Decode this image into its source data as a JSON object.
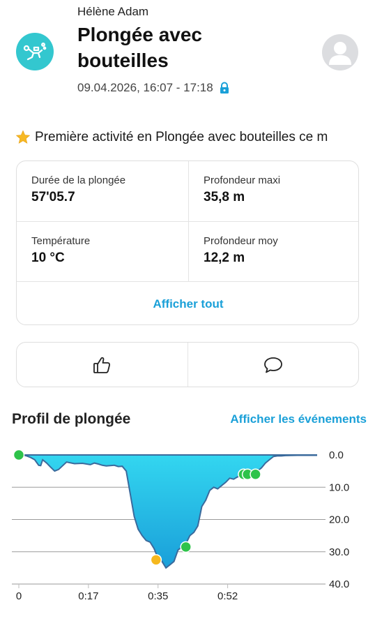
{
  "header": {
    "user_name": "Hélène Adam",
    "title": "Plongée avec bouteilles",
    "datetime": "09.04.2026, 16:07 - 17:18",
    "activity_icon": "scuba-diver-icon",
    "lock_icon": "lock-icon",
    "avatar_icon": "user-avatar-icon",
    "accent_color": "#33c7cf"
  },
  "achievement": {
    "icon": "star-icon",
    "text": "Première activité en Plongée avec bouteilles ce m"
  },
  "stats": {
    "duration": {
      "label": "Durée de la plongée",
      "value": "57'05.7"
    },
    "max_depth": {
      "label": "Profondeur maxi",
      "value": "35,8 m"
    },
    "temperature": {
      "label": "Température",
      "value": "10 °C"
    },
    "avg_depth": {
      "label": "Profondeur moy",
      "value": "12,2 m"
    },
    "show_all": "Afficher tout"
  },
  "actions": {
    "like_icon": "thumbs-up-icon",
    "comment_icon": "comment-icon"
  },
  "profile": {
    "title": "Profil de plongée",
    "events_link": "Afficher les événements"
  },
  "chart_data": {
    "type": "area",
    "title": "",
    "xlabel": "",
    "ylabel": "",
    "x_ticks": [
      "0",
      "0:17",
      "0:35",
      "0:52"
    ],
    "x_tick_minutes": [
      0,
      17.5,
      35,
      52.5
    ],
    "y_ticks": [
      "0.0",
      "10.0",
      "20.0",
      "30.0",
      "40.0"
    ],
    "ylim": [
      0,
      40
    ],
    "xlim": [
      0,
      75
    ],
    "y_inverted": true,
    "grid": true,
    "series": [
      {
        "color": "#1fb4e4",
        "x": [
          0,
          1,
          2,
          3,
          4,
          5,
          5.5,
          6,
          7,
          8,
          9,
          10,
          12,
          14,
          16,
          18,
          19,
          20,
          21,
          22,
          23,
          24,
          25,
          26,
          27,
          28,
          29,
          30,
          31,
          32,
          33,
          34,
          35,
          36,
          37,
          38,
          39,
          40,
          41,
          42,
          43,
          44,
          45,
          46,
          47,
          48,
          49,
          50,
          51,
          52,
          53,
          54,
          55,
          56,
          57,
          58,
          59,
          60,
          61,
          62,
          63,
          64,
          65,
          66,
          67,
          70,
          72,
          75
        ],
        "y": [
          0,
          0,
          0.3,
          0.8,
          1.5,
          3.2,
          3.3,
          1.5,
          2.5,
          3.8,
          5,
          4.5,
          2.2,
          2.7,
          2.6,
          3,
          2.5,
          2.8,
          3.2,
          3.4,
          3.3,
          3.2,
          3.6,
          3.5,
          5,
          12,
          19,
          23,
          25,
          26.5,
          27,
          29,
          32,
          33,
          35,
          34,
          33,
          29.5,
          28.5,
          27.5,
          25,
          24,
          22,
          16,
          14,
          11,
          10,
          10.5,
          9.5,
          8.5,
          7.2,
          7.5,
          6.8,
          6.5,
          6,
          6,
          5.8,
          5,
          4,
          2.5,
          1.5,
          0.5,
          0.3,
          0.3,
          0.2,
          0.1,
          0.1,
          0.1
        ]
      }
    ],
    "events": [
      {
        "x": 0,
        "y": 0,
        "color": "#2ec34a",
        "kind": "start"
      },
      {
        "x": 34.5,
        "y": 32.5,
        "color": "#f5b81e",
        "kind": "warning"
      },
      {
        "x": 42,
        "y": 28.5,
        "color": "#2ec34a",
        "kind": "event"
      },
      {
        "x": 56.5,
        "y": 6,
        "color": "#2ec34a",
        "kind": "event"
      },
      {
        "x": 57.5,
        "y": 6,
        "color": "#2ec34a",
        "kind": "event"
      },
      {
        "x": 59.5,
        "y": 6,
        "color": "#2ec34a",
        "kind": "event"
      }
    ]
  }
}
